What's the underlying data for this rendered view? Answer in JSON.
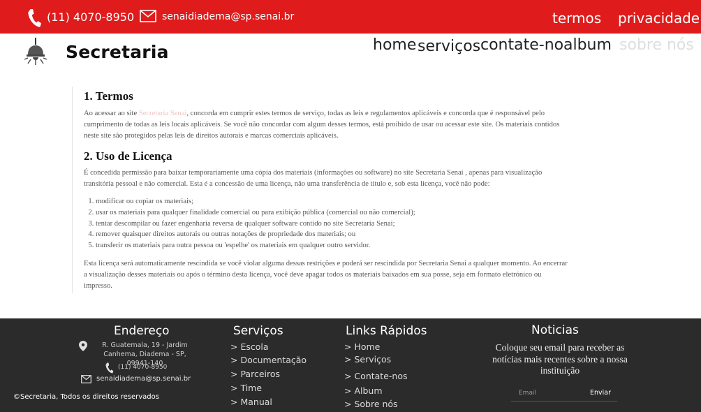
{
  "topbar": {
    "phone": "(11) 4070-8950",
    "email": "senaidiadema@sp.senai.br",
    "links": {
      "terms": "termos",
      "privacy": "privacidade"
    },
    "icons": {
      "phone": "phone-icon",
      "email": "envelope-icon"
    },
    "color": "#e01b1b"
  },
  "header": {
    "brand": "Secretaria",
    "logo_icon": "ceiling-lamp-icon",
    "nav": {
      "home": "home",
      "servicos": "serviços",
      "contate": "contate-no",
      "album": "album",
      "sobre": "sobre nós"
    }
  },
  "content": {
    "section1": {
      "title": "1. Termos",
      "p_before": "Ao acessar ao site ",
      "link": "Secretaria Senai",
      "p_after": ", concorda em cumprir estes termos de serviço, todas as leis e regulamentos aplicáveis e concorda que é responsável pelo cumprimento de todas as leis locais aplicáveis. Se você não concordar com algum desses termos, está proibido de usar ou acessar este site. Os materiais contidos neste site são protegidos pelas leis de direitos autorais e marcas comerciais aplicáveis."
    },
    "section2": {
      "title": "2. Uso de Licença",
      "intro": "É concedida permissão para baixar temporariamente uma cópia dos materiais (informações ou software) no site Secretaria Senai , apenas para visualização transitória pessoal e não comercial. Esta é a concessão de uma licença, não uma transferência de título e, sob esta licença, você não pode:",
      "items": [
        "modificar ou copiar os materiais;",
        "usar os materiais para qualquer finalidade comercial ou para exibição pública (comercial ou não comercial);",
        "tentar descompilar ou fazer engenharia reversa de qualquer software contido no site Secretaria Senai;",
        "remover quaisquer direitos autorais ou outras notações de propriedade dos materiais; ou",
        "transferir os materiais para outra pessoa ou 'espelhe' os materiais em qualquer outro servidor."
      ],
      "closing": "Esta licença será automaticamente rescindida se você violar alguma dessas restrições e poderá ser rescindida por Secretaria Senai a qualquer momento. Ao encerrar a visualização desses materiais ou após o término desta licença, você deve apagar todos os materiais baixados em sua posse, seja em formato eletrónico ou impresso."
    }
  },
  "footer": {
    "endereco": {
      "title": "Endereço",
      "address": "R. Guatemala, 19 - Jardim Canhema, Diadema - SP, 09941-140",
      "phone": "(11) 4070-8950",
      "email": "senaidiadema@sp.senai.br"
    },
    "servicos": {
      "title": "Serviços",
      "items": [
        "> Escola",
        "> Documentação",
        "> Parceiros",
        "> Time",
        "> Manual"
      ]
    },
    "links": {
      "title": "Links Rápidos",
      "items": [
        "> Home",
        "> Serviços",
        "> Contate-nos",
        "> Album",
        "> Sobre nós"
      ]
    },
    "noticias": {
      "title": "Noticias",
      "text": "Coloque seu email para receber as notícias mais recentes sobre a nossa instituição",
      "placeholder": "Email",
      "button": "Enviar"
    },
    "copyright": "©Secretaria, Todos os direitos reservados",
    "color": "#2b2b2b"
  }
}
